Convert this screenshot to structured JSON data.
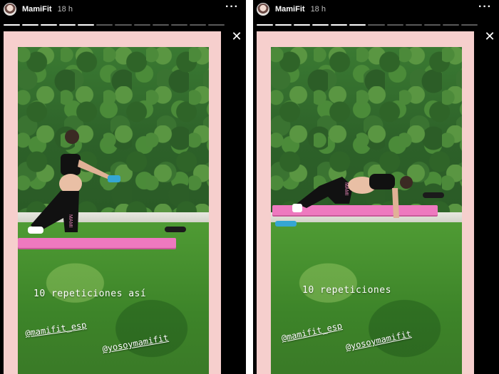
{
  "stories": [
    {
      "username": "MamiFit",
      "time": "18 h",
      "more_icon": "···",
      "close_icon": "✕",
      "caption": "10 repeticiones así",
      "mentions": [
        "@mamifit_esp",
        "@yosoymamifit"
      ],
      "shirt_text": "MAMI"
    },
    {
      "username": "MamiFit",
      "time": "18 h",
      "more_icon": "···",
      "close_icon": "✕",
      "caption": "10 repeticiones",
      "mentions": [
        "@mamifit_esp",
        "@yosoymamifit"
      ],
      "shirt_text": "MAMI"
    }
  ],
  "colors": {
    "frame_pink": "#f6cfcd",
    "mat_pink": "#ee79bf",
    "grass": "#4f9b34",
    "hedge": "#2d6129"
  },
  "icons": {
    "avatar": "avatar-icon",
    "more": "more-options-icon",
    "close": "close-icon"
  }
}
